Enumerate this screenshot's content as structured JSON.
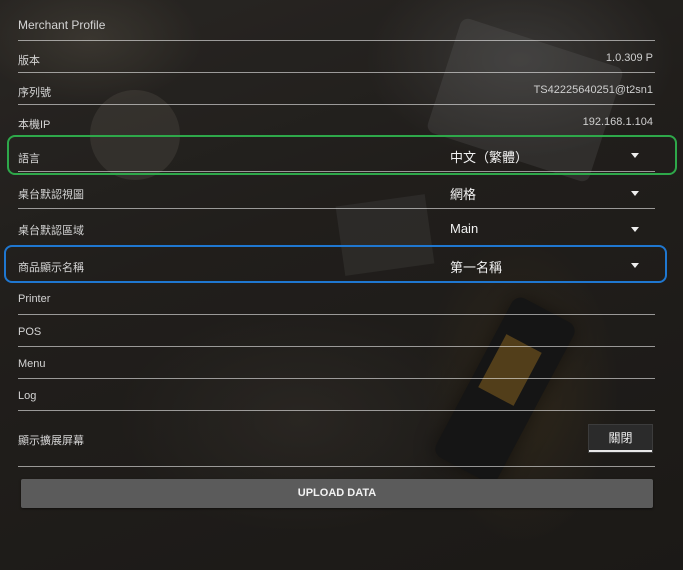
{
  "header": {
    "title": "Merchant Profile"
  },
  "info_rows": [
    {
      "label": "版本",
      "value": "1.0.309 P"
    },
    {
      "label": "序列號",
      "value": "TS42225640251@t2sn1"
    },
    {
      "label": "本機IP",
      "value": "192.168.1.104"
    }
  ],
  "dropdown_rows": [
    {
      "label": "語言",
      "value": "中文（繁體）"
    },
    {
      "label": "桌台默認視圖",
      "value": "網格"
    },
    {
      "label": "桌台默認區域",
      "value": "Main"
    },
    {
      "label": "商品顯示名稱",
      "value": "第一名稱"
    }
  ],
  "nav_rows": [
    {
      "label": "Printer"
    },
    {
      "label": "POS"
    },
    {
      "label": "Menu"
    },
    {
      "label": "Log"
    }
  ],
  "extended_screen": {
    "label": "顯示擴展屏幕",
    "toggle_label": "關閉"
  },
  "upload": {
    "label": "UPLOAD DATA"
  },
  "colors": {
    "highlight_green": "#2ea84a",
    "highlight_blue": "#1f77d0",
    "upload_button": "#5b5b5b"
  }
}
